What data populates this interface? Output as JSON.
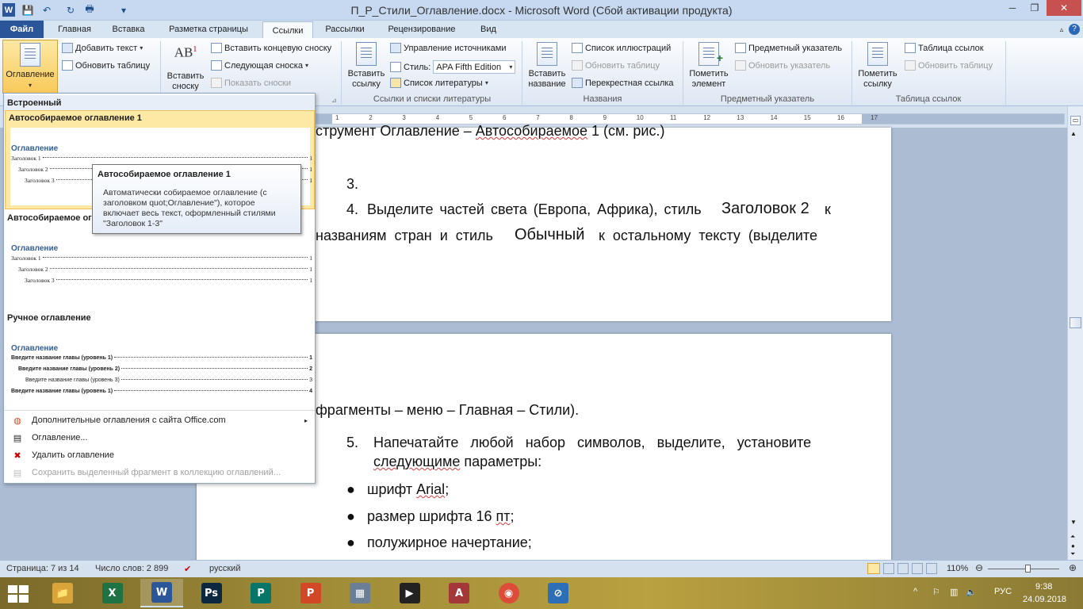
{
  "window": {
    "title": "П_Р_Стили_Оглавление.docx  -  Microsoft Word (Сбой активации продукта)",
    "qat": [
      "W",
      "💾",
      "↶",
      "↻",
      "🖶",
      "▾"
    ],
    "controls": {
      "minimize": "─",
      "restore": "❐",
      "close": "✕"
    },
    "help": "?"
  },
  "tabs": [
    {
      "label": "Файл"
    },
    {
      "label": "Главная"
    },
    {
      "label": "Вставка"
    },
    {
      "label": "Разметка страницы"
    },
    {
      "label": "Ссылки"
    },
    {
      "label": "Рассылки"
    },
    {
      "label": "Рецензирование"
    },
    {
      "label": "Вид"
    }
  ],
  "ribbon": {
    "toc": {
      "big_label": "Оглавление",
      "add_text": "Добавить текст",
      "update_table": "Обновить таблицу"
    },
    "footnotes": {
      "big_label": "Вставить\nсноску",
      "insert_endnote": "Вставить концевую сноску",
      "next_footnote": "Следующая сноска",
      "show_notes": "Показать сноски",
      "ab_icon": "AB",
      "ab_sup": "1"
    },
    "citations": {
      "big_label": "Вставить\nссылку",
      "manage_sources": "Управление источниками",
      "style_label": "Стиль:",
      "style_value": "APA Fifth Edition",
      "bibliography": "Список литературы",
      "group_label": "Ссылки и списки литературы"
    },
    "captions": {
      "big_label": "Вставить\nназвание",
      "list_illustrations": "Список иллюстраций",
      "update_table": "Обновить таблицу",
      "cross_ref": "Перекрестная ссылка",
      "group_label": "Названия"
    },
    "index": {
      "big_label": "Пометить\nэлемент",
      "insert_index": "Предметный указатель",
      "update_index": "Обновить указатель",
      "group_label": "Предметный указатель"
    },
    "authorities": {
      "big_label": "Пометить\nссылку",
      "insert_table": "Таблица ссылок",
      "update_table": "Обновить таблицу",
      "group_label": "Таблица ссылок"
    }
  },
  "ruler": {
    "marks": [
      "1",
      "2",
      "3",
      "4",
      "5",
      "6",
      "7",
      "8",
      "9",
      "10",
      "11",
      "12",
      "13",
      "14",
      "15",
      "16",
      "17"
    ]
  },
  "document": {
    "line1_prefix": "струмент Оглавление – ",
    "line1_squig": "Автособираемое",
    "line1_suffix": " 1 (см. рис.)",
    "item3": "3.",
    "item4_num": "4.",
    "item4_text_a": "Выделите частей света (Европа, Африка), стиль",
    "item4_style": "Заголовок 2",
    "item4_text_b": "к",
    "item4_line2_a": "названиям  стран  и  стиль",
    "item4_line2_style": "Обычный",
    "item4_line2_b": "к  остальному  тексту  (выделите",
    "frag_line": "фрагменты – меню – Главная – Стили).",
    "item5_num": "5.",
    "item5_line1": "Напечатайте   любой   набор   символов,   выделите,   установите",
    "item5_line2_squig": "следующиме",
    "item5_line2_rest": " параметры:",
    "bullets": [
      {
        "a": "шрифт ",
        "squig": "Arial",
        "b": ";"
      },
      {
        "a": "размер шрифта 16 ",
        "squig": "пт",
        "b": ";"
      },
      {
        "a": "полужирное начертание;",
        "squig": "",
        "b": ""
      }
    ]
  },
  "toc_menu": {
    "section_builtin": "Встроенный",
    "auto1_title": "Автособираемое оглавление 1",
    "auto2_title": "Автособираемое ог",
    "manual_title": "Ручное оглавление",
    "preview_heading": "Оглавление",
    "auto_lines": [
      {
        "text": "Заголовок 1",
        "page": "1"
      },
      {
        "text": "Заголовок 2",
        "page": "1"
      },
      {
        "text": "Заголовок 3",
        "page": "1"
      }
    ],
    "manual_lines": [
      {
        "text": "Введите название главы (уровень 1)",
        "page": "1"
      },
      {
        "text": "Введите название главы (уровень 2)",
        "page": "2"
      },
      {
        "text": "Введите название главы (уровень 3)",
        "page": "3"
      },
      {
        "text": "Введите название главы (уровень 1)",
        "page": "4"
      }
    ],
    "more_online": "Дополнительные оглавления с сайта Office.com",
    "toc_dialog": "Оглавление...",
    "remove_toc": "Удалить оглавление",
    "save_selection": "Сохранить выделенный фрагмент в коллекцию оглавлений..."
  },
  "tooltip": {
    "title": "Автособираемое оглавление 1",
    "body": "Автоматически собираемое оглавление (с заголовком quot;Оглавление\"), которое включает весь текст, оформленный стилями \"Заголовок 1-3\""
  },
  "status": {
    "page": "Страница: 7 из 14",
    "words": "Число слов: 2 899",
    "language": "русский",
    "zoom": "110%"
  },
  "taskbar": {
    "apps": [
      {
        "name": "explorer",
        "glyph": "📁",
        "color": "#d9a53a"
      },
      {
        "name": "excel",
        "glyph": "X",
        "color": "#1f7244"
      },
      {
        "name": "word",
        "glyph": "W",
        "color": "#2b579a"
      },
      {
        "name": "photoshop",
        "glyph": "Ps",
        "color": "#0c2840"
      },
      {
        "name": "publisher",
        "glyph": "P",
        "color": "#077568"
      },
      {
        "name": "powerpoint",
        "glyph": "P",
        "color": "#d24726"
      },
      {
        "name": "calculator",
        "glyph": "▦",
        "color": "#6a7f96"
      },
      {
        "name": "video",
        "glyph": "▶",
        "color": "#222222"
      },
      {
        "name": "access",
        "glyph": "A",
        "color": "#a4373a"
      },
      {
        "name": "chrome",
        "glyph": "◉",
        "color": "#dd4b39"
      },
      {
        "name": "app",
        "glyph": "⊘",
        "color": "#2c6fb6"
      }
    ],
    "lang": "РУС",
    "time": "9:38",
    "date": "24.09.2018"
  },
  "colors": {
    "accent": "#2a5699",
    "tooltip_hl": "#fcd56a"
  }
}
